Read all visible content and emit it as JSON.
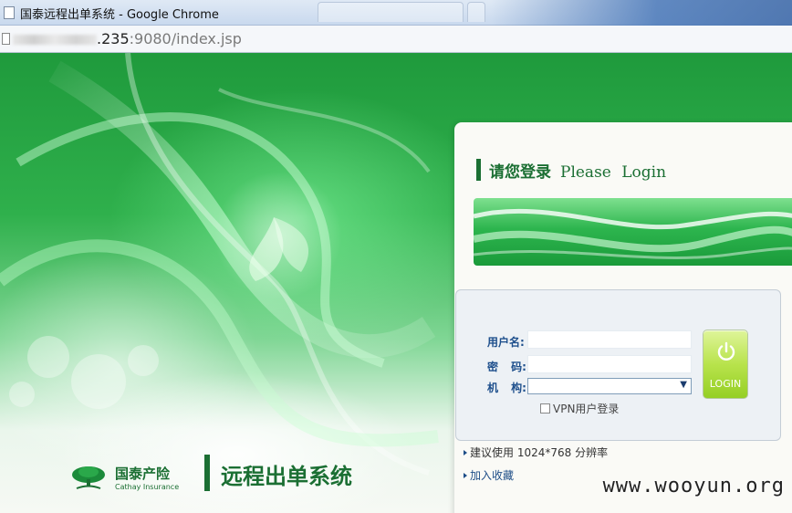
{
  "window": {
    "title": "国泰远程出单系统 - Google Chrome"
  },
  "address_bar": {
    "url_host": ".235",
    "url_path": ":9080/index.jsp"
  },
  "login_panel": {
    "heading_cn": "请您登录",
    "heading_en": "Please Login",
    "username_label": "用户名:",
    "username_value": "",
    "password_label": "密 码:",
    "password_value": "",
    "org_label": "机 构:",
    "org_selected": "",
    "vpn_label": "VPN用户登录",
    "login_button_label": "LOGIN",
    "resolution_tip": "建议使用 1024*768 分辨率",
    "bookmark_link": "加入收藏"
  },
  "branding": {
    "company_cn": "国泰产险",
    "company_en": "Cathay Insurance",
    "system_name": "远程出单系统"
  },
  "watermark": "www.wooyun.org",
  "colors": {
    "brand_green": "#1b6f33",
    "label_blue": "#1e4f8c",
    "login_button": "#b8e34c"
  }
}
